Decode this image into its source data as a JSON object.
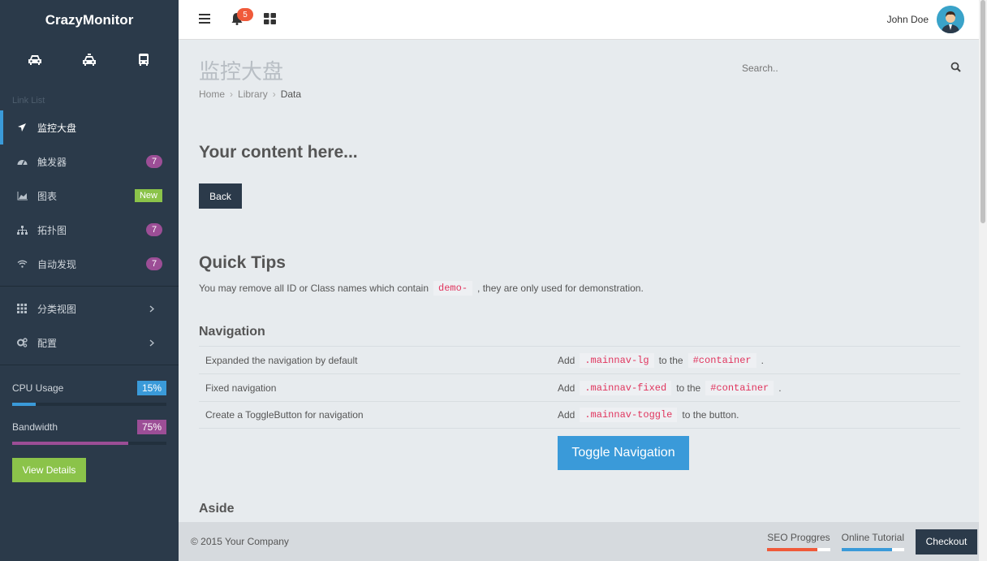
{
  "brand": "CrazyMonitor",
  "shortcuts": [
    "car-icon",
    "taxi-icon",
    "bus-icon"
  ],
  "sidebar": {
    "list_header": "Link List",
    "items": [
      {
        "label": "监控大盘",
        "icon": "plane-icon",
        "active": true
      },
      {
        "label": "触发器",
        "icon": "dashboard-icon",
        "badge": "7"
      },
      {
        "label": "图表",
        "icon": "area-chart-icon",
        "badge": "New"
      },
      {
        "label": "拓扑图",
        "icon": "sitemap-icon",
        "badge": "7"
      },
      {
        "label": "自动发现",
        "icon": "wifi-icon",
        "badge": "7"
      }
    ],
    "groups": [
      {
        "label": "分类视图",
        "icon": "grid-icon"
      },
      {
        "label": "配置",
        "icon": "gears-icon"
      }
    ],
    "stats": [
      {
        "label": "CPU Usage",
        "value": "15%",
        "percent": 15,
        "color": "#3a9ad9"
      },
      {
        "label": "Bandwidth",
        "value": "75%",
        "percent": 75,
        "color": "#9c4e96"
      }
    ],
    "view_details": "View Details"
  },
  "topbar": {
    "notifications": "5",
    "user_name": "John Doe"
  },
  "page": {
    "title": "监控大盘",
    "breadcrumb": [
      "Home",
      "Library",
      "Data"
    ],
    "search_placeholder": "Search..",
    "content_heading": "Your content here...",
    "back_button": "Back",
    "tips_heading": "Quick Tips",
    "tips_text_before": "You may remove all ID or Class names which contain",
    "tips_code": "demo-",
    "tips_text_after": ", they are only used for demonstration.",
    "nav_heading": "Navigation",
    "nav_rows": [
      {
        "desc": "Expanded the navigation by default",
        "add": "Add",
        "code1": ".mainnav-lg",
        "mid": "to the",
        "code2": "#container",
        "end": "."
      },
      {
        "desc": "Fixed navigation",
        "add": "Add",
        "code1": ".mainnav-fixed",
        "mid": "to the",
        "code2": "#container",
        "end": "."
      },
      {
        "desc": "Create a ToggleButton for navigation",
        "add": "Add",
        "code1": ".mainnav-toggle",
        "mid": "to the button.",
        "code2": "",
        "end": ""
      }
    ],
    "toggle_button": "Toggle Navigation",
    "aside_heading": "Aside"
  },
  "footer": {
    "copyright": "© 2015 Your Company",
    "seo_label": "SEO Proggres",
    "seo_percent": 80,
    "tutorial_label": "Online Tutorial",
    "tutorial_percent": 80,
    "checkout": "Checkout"
  }
}
